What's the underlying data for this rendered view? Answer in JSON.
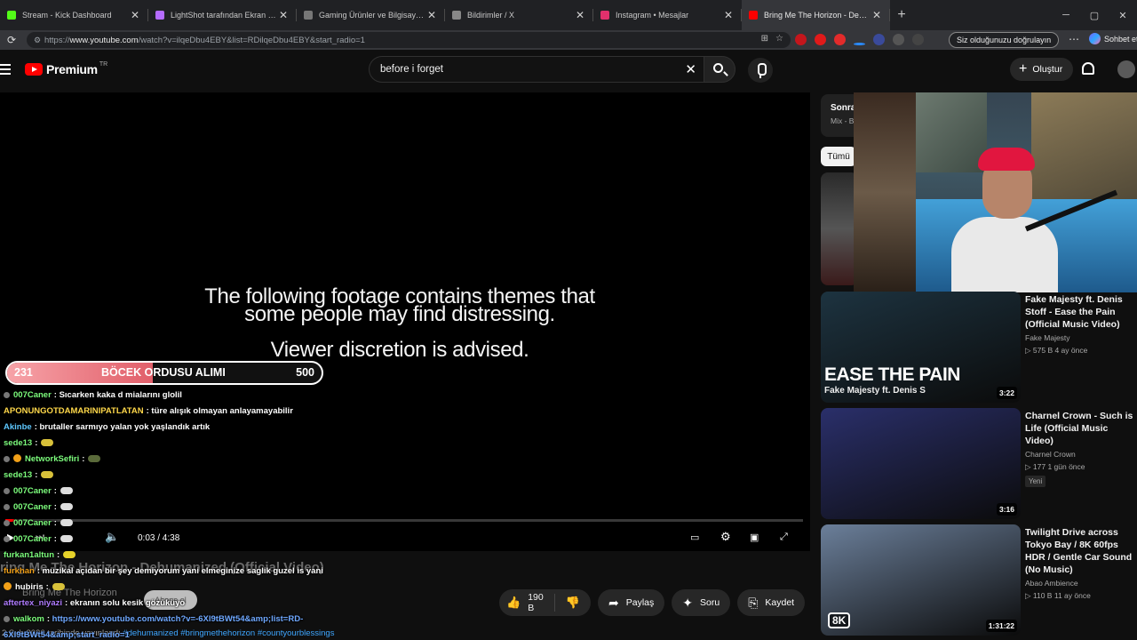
{
  "browser": {
    "tabs": [
      {
        "title": "Stream - Kick Dashboard",
        "fav_color": "#53fc18"
      },
      {
        "title": "LightShot tarafından Ekran Görünt",
        "fav_color": "#b56cff"
      },
      {
        "title": "Gaming Ürünler ve Bilgisayar Bile",
        "fav_color": "#777777"
      },
      {
        "title": "Bildirimler / X",
        "fav_color": "#888888"
      },
      {
        "title": "Instagram • Mesajlar",
        "fav_color": "#e1306c"
      },
      {
        "title": "Bring Me The Horizon - Dehuman",
        "fav_color": "#ff0000"
      }
    ],
    "url_prefix": "https://",
    "url_host": "www.youtube.com",
    "url_rest": "/watch?v=ilqeDbu4EBY&list=RDilqeDbu4EBY&start_radio=1",
    "verify_label": "Siz olduğunuzu doğrulayın",
    "chat_label": "Sohbet et"
  },
  "youtube": {
    "logo_text": "Premium",
    "region": "TR",
    "search_value": "before i forget",
    "create_label": "Oluştur"
  },
  "player": {
    "warning_line1": "The following footage contains themes that",
    "warning_line2": "some people may find distressing.",
    "warning_line3": "Viewer discretion is advised.",
    "time": "0:03 / 4:38",
    "progress": 0.011
  },
  "goal": {
    "current": "231",
    "label": "BÖCEK ORDUSU ALIMI",
    "target": "500",
    "fraction": 0.462
  },
  "chat": [
    {
      "user": "007Caner",
      "color": "#7cfc7c",
      "text": ": Sıcarken kaka d mialarını glolil",
      "badge": "dot"
    },
    {
      "user": "APONUNGOTDAMARINIPATLATAN",
      "color": "#ffd84a",
      "text": ": türe alışık olmayan anlayamayabilir",
      "badge": ""
    },
    {
      "user": "Akinbe",
      "color": "#5ec8ff",
      "text": ": brutaller sarmıyo yalan yok yaşlandık artık",
      "badge": ""
    },
    {
      "user": "sede13",
      "color": "#7cfc7c",
      "text": ":",
      "badge": "",
      "emote": "#d8c13a"
    },
    {
      "user": "NetworkSefiri",
      "color": "#7cfc7c",
      "text": ":",
      "badge": "both",
      "emote": "#5a6a3a"
    },
    {
      "user": "sede13",
      "color": "#7cfc7c",
      "text": ":",
      "badge": "",
      "emote": "#d8c13a"
    },
    {
      "user": "007Caner",
      "color": "#7cfc7c",
      "text": ":",
      "badge": "dot",
      "emote": "#dddddd"
    },
    {
      "user": "007Caner",
      "color": "#7cfc7c",
      "text": ":",
      "badge": "dot",
      "emote": "#dddddd"
    },
    {
      "user": "007Caner",
      "color": "#7cfc7c",
      "text": ":",
      "badge": "dot",
      "emote": "#dddddd"
    },
    {
      "user": "007Caner",
      "color": "#7cfc7c",
      "text": ":",
      "badge": "dot",
      "emote": "#dddddd"
    },
    {
      "user": "furkan1altun",
      "color": "#7cfc7c",
      "text": ":",
      "badge": "",
      "emote": "#e6d22a"
    },
    {
      "user": "furkhan",
      "color": "#f2a018",
      "text": ": müzikal açıdan bir şey demiyorum yani elmeginize saglik guzel is yani",
      "badge": ""
    },
    {
      "user": "hubiris",
      "color": "#ffffff",
      "text": ":",
      "badge": "coin",
      "emote": "#d8c13a"
    },
    {
      "user": "aftertex_niyazi",
      "color": "#b07cff",
      "text": ": ekranın solu kesik gözüküyo",
      "badge": ""
    },
    {
      "user": "walkom",
      "color": "#7cfc7c",
      "text": ":",
      "badge": "dot",
      "link": "https://www.youtube.com/watch?v=-6Xl9tBWt54&amp;list=RD-"
    },
    {
      "user": "",
      "color": "#ffffff",
      "text": "",
      "badge": "",
      "link": "6Xl9tBWt54&amp;start_radio=1"
    }
  ],
  "below": {
    "title": "ring Me The Horizon - Dehumanized (Official Video)",
    "channel": "Bring Me The Horizon",
    "subscribe_label": "Abone ol",
    "likes": "190 B",
    "share_label": "Paylaş",
    "ask_label": "Soru",
    "save_label": "Kaydet",
    "published": "2 Şub 2026 tarihinde yayınlandı",
    "hashtags": "#dehumanized #bringmethehorizon #countyourblessings"
  },
  "sidebar": {
    "next_label": "Sonra",
    "mix_label": "Mix - B",
    "chip_label": "Tümü",
    "recs": [
      {
        "title": "Fake Majesty ft. Denis Stoff - Ease the Pain (Official Music Video)",
        "channel": "Fake Majesty",
        "stats": "▷ 575 B  4 ay önce",
        "badge": "",
        "duration": "3:22",
        "thumb": "#1d3340"
      },
      {
        "title": "Charnel Crown - Such is Life (Official Music Video)",
        "channel": "Charnel Crown",
        "stats": "▷ 177  1 gün önce",
        "badge": "Yeni",
        "duration": "3:16",
        "thumb": "#2a2f6a"
      },
      {
        "title": "Twilight Drive across Tokyo Bay / 8K 60fps HDR / Gentle Car Sound (No Music)",
        "channel": "Abao Ambience",
        "stats": "▷ 110 B  11 ay önce",
        "badge": "",
        "duration": "1:31:22",
        "thumb": "#6b7f9a"
      }
    ],
    "ease_text": "EASE THE PAIN",
    "ease_sub": "Fake Majesty ft. Denis S",
    "eightk": "8K"
  }
}
